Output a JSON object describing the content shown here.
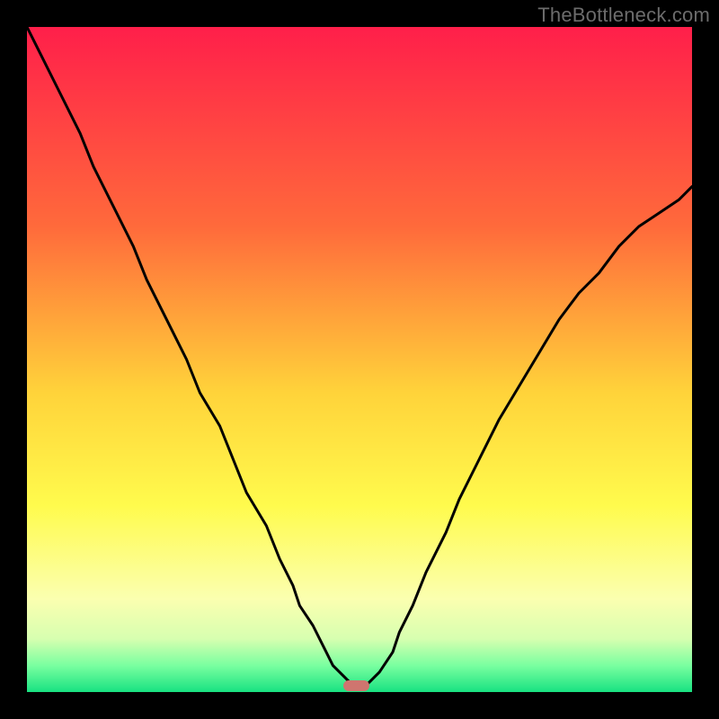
{
  "watermark": "TheBottleneck.com",
  "chart_data": {
    "type": "line",
    "title": "",
    "xlabel": "",
    "ylabel": "",
    "xlim": [
      0,
      100
    ],
    "ylim": [
      0,
      100
    ],
    "x": [
      0,
      2,
      5,
      8,
      10,
      13,
      16,
      18,
      21,
      24,
      26,
      29,
      31,
      33,
      36,
      38,
      40,
      41,
      43,
      44,
      45,
      46,
      47,
      48,
      49,
      50,
      51,
      52,
      53,
      55,
      56,
      58,
      60,
      63,
      65,
      68,
      71,
      74,
      77,
      80,
      83,
      86,
      89,
      92,
      95,
      98,
      100
    ],
    "values": [
      100,
      96,
      90,
      84,
      79,
      73,
      67,
      62,
      56,
      50,
      45,
      40,
      35,
      30,
      25,
      20,
      16,
      13,
      10,
      8,
      6,
      4,
      3,
      2,
      1,
      1,
      1,
      2,
      3,
      6,
      9,
      13,
      18,
      24,
      29,
      35,
      41,
      46,
      51,
      56,
      60,
      63,
      67,
      70,
      72,
      74,
      76
    ],
    "background_gradient": {
      "stops": [
        {
          "pos": 0.0,
          "color": "#ff1f4a"
        },
        {
          "pos": 0.3,
          "color": "#ff6a3b"
        },
        {
          "pos": 0.55,
          "color": "#ffd33a"
        },
        {
          "pos": 0.72,
          "color": "#fffb4d"
        },
        {
          "pos": 0.86,
          "color": "#fbffb0"
        },
        {
          "pos": 0.92,
          "color": "#d7ffb0"
        },
        {
          "pos": 0.96,
          "color": "#7affa0"
        },
        {
          "pos": 1.0,
          "color": "#18e281"
        }
      ]
    },
    "marker": {
      "x": 49.5,
      "y": 1,
      "w": 4,
      "h": 1.6,
      "color": "#cf756f"
    },
    "curve_color": "#000000"
  }
}
